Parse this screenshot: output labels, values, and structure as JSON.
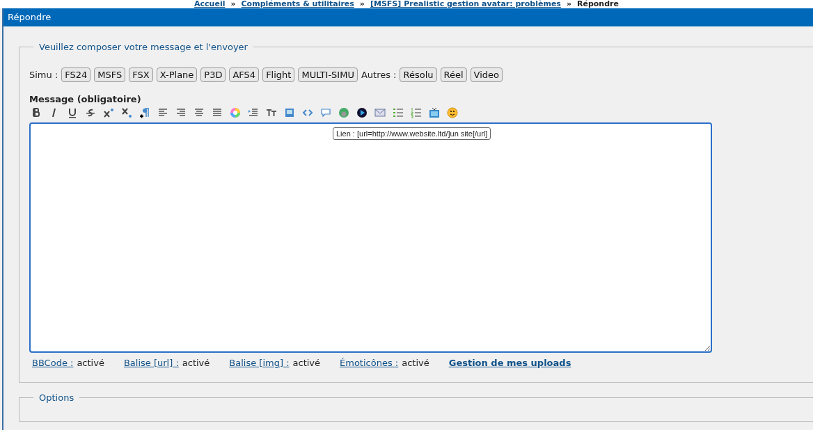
{
  "breadcrumb": [
    "Accueil",
    "Compléments & utilitaires",
    "[MSFS] Prealistic gestion avatar: problèmes",
    "Répondre"
  ],
  "breadcrumb_separator": "»",
  "header": {
    "title": "Répondre"
  },
  "compose": {
    "legend": "Veuillez composer votre message et l'envoyer",
    "simu_label": "Simu :",
    "simu_tags": [
      "FS24",
      "MSFS",
      "FSX",
      "X-Plane",
      "P3D",
      "AFS4",
      "Flight",
      "MULTI-SIMU"
    ],
    "other_label": "Autres :",
    "other_tags": [
      "Résolu",
      "Réel",
      "Video"
    ],
    "message_label": "Message (obligatoire)",
    "tooltip": "Lien : [url=http://www.website.ltd/]un site[/url]",
    "status": [
      {
        "link": "BBCode :",
        "value": "activé"
      },
      {
        "link": "Balise [url] :",
        "value": "activé"
      },
      {
        "link": "Balise [img] :",
        "value": "activé"
      },
      {
        "link": "Émoticônes :",
        "value": "activé"
      }
    ],
    "uploads_link": "Gestion de mes uploads"
  },
  "options": {
    "legend": "Options"
  }
}
